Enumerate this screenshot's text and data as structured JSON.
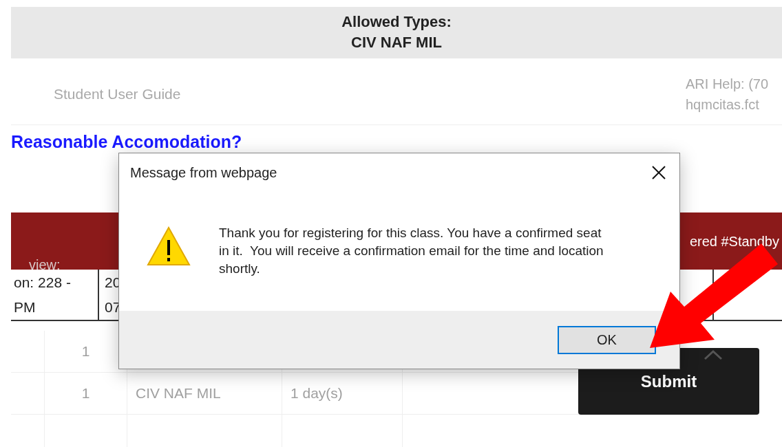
{
  "page": {
    "allowed_types_label": "Allowed Types:",
    "allowed_types": "CIV NAF MIL",
    "links": [
      "Student User Guide"
    ],
    "help_lines": [
      "ARI Help: (70",
      "hqmcitas.fct"
    ],
    "accommodation_link": "Reasonable Accomodation?",
    "band_text": "ered #Standby",
    "ghost_text": "view:",
    "session_cells": [
      [
        "on: 228 -",
        "PM"
      ],
      [
        "20",
        "07"
      ]
    ],
    "rows": [
      {
        "cells": [
          "1"
        ]
      },
      {
        "cells": [
          "1",
          "CIV NAF MIL",
          "1 day(s)"
        ]
      }
    ],
    "submit_button": "Submit"
  },
  "dialog": {
    "title": "Message from webpage",
    "message": "Thank you for registering for this class. You have a confirmed seat in it.  You will receive a confirmation email for the time and location shortly.",
    "buttons": [
      {
        "label": "OK",
        "focused": true
      }
    ]
  }
}
